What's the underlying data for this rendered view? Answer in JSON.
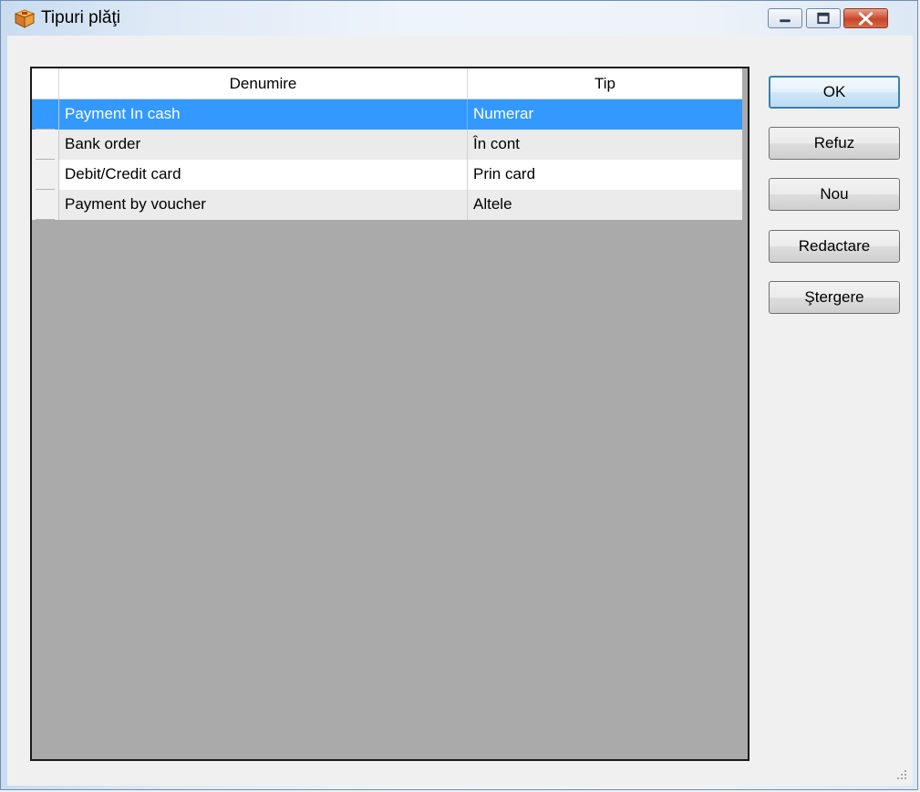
{
  "window": {
    "title": "Tipuri plăţi",
    "icons": {
      "app": "box-icon",
      "minimize": "minimize-icon",
      "maximize": "maximize-icon",
      "close": "close-icon"
    }
  },
  "grid": {
    "columns": [
      "Denumire",
      "Tip"
    ],
    "rows": [
      {
        "denumire": "Payment In cash",
        "tip": "Numerar"
      },
      {
        "denumire": "Bank order",
        "tip": "În cont"
      },
      {
        "denumire": "Debit/Credit card",
        "tip": "Prin card"
      },
      {
        "denumire": "Payment by voucher",
        "tip": "Altele"
      }
    ],
    "selected_row": 0,
    "selection_color": "#3399ff"
  },
  "buttons": {
    "ok": "OK",
    "refuz": "Refuz",
    "nou": "Nou",
    "redactare": "Redactare",
    "stergere": "Ştergere"
  }
}
